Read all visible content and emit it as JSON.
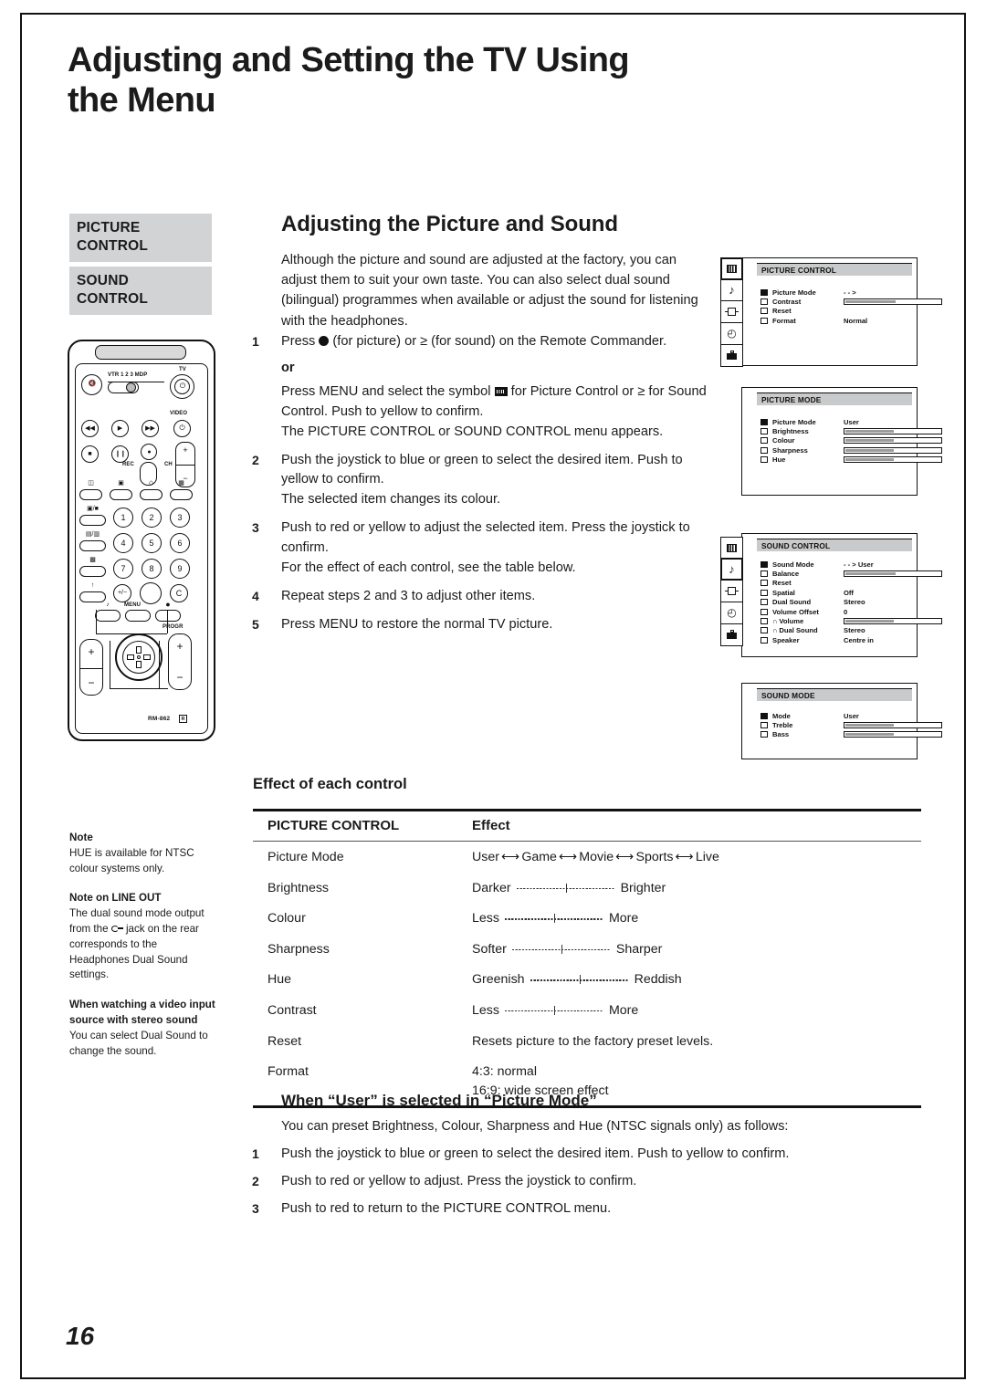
{
  "page": {
    "title_line1": "Adjusting and Setting the TV Using",
    "title_line2": "the Menu",
    "number": "16"
  },
  "sidebar": {
    "tabs": [
      {
        "line1": "PICTURE",
        "line2": "CONTROL"
      },
      {
        "line1": "SOUND",
        "line2": "CONTROL"
      }
    ]
  },
  "remote": {
    "source_labels": "VTR 1 2 3 MDP",
    "tv_label": "TV",
    "video_label": "VIDEO",
    "rec_label": "REC",
    "ch_label": "CH",
    "menu_label": "MENU",
    "progr_label": "PROGR",
    "keys": [
      "1",
      "2",
      "3",
      "4",
      "5",
      "6",
      "7",
      "8",
      "9"
    ],
    "clear_key": "C",
    "model": "RM-862",
    "region_mark": "R"
  },
  "main": {
    "section_title": "Adjusting the Picture and Sound",
    "intro": "Although the picture and sound are adjusted at the factory, you can adjust them to suit your own taste. You can also select dual sound (bilingual) programmes when available or adjust the sound for listening with the headphones.",
    "or_label": "or",
    "steps": [
      {
        "num": "1",
        "text_before_dot": "Press ",
        "text_after_dot": " (for picture) or ≥ (for sound) on the Remote Commander."
      },
      {
        "num": "",
        "text_before_sym": "Press MENU and select the symbol ",
        "text_after_sym": " for Picture Control or ≥ for Sound Control.  Push to yellow to confirm.",
        "sub": "The PICTURE CONTROL or SOUND CONTROL menu appears."
      },
      {
        "num": "2",
        "main": "Push the joystick to blue or green to select the desired item.  Push to yellow to confirm.",
        "sub": "The selected item changes its colour."
      },
      {
        "num": "3",
        "main": "Push to red or yellow to adjust the selected item.  Press the joystick to confirm.",
        "sub": "For the effect of each control, see the table below."
      },
      {
        "num": "4",
        "main": "Repeat steps 2 and 3 to adjust other items."
      },
      {
        "num": "5",
        "main": "Press MENU to restore the normal TV picture."
      }
    ]
  },
  "osd": {
    "picture_control": {
      "title": "PICTURE CONTROL",
      "rows": [
        {
          "selected": true,
          "label": "Picture Mode",
          "value": "- - >",
          "type": "value"
        },
        {
          "selected": false,
          "label": "Contrast",
          "bar": 52,
          "type": "bar"
        },
        {
          "selected": false,
          "label": "Reset",
          "value": "",
          "type": "value"
        },
        {
          "selected": false,
          "label": "Format",
          "value": "Normal",
          "type": "value"
        }
      ]
    },
    "picture_mode": {
      "title": "PICTURE MODE",
      "rows": [
        {
          "selected": true,
          "label": "Picture Mode",
          "value": "User",
          "type": "value"
        },
        {
          "selected": false,
          "label": "Brightness",
          "bar": 50,
          "type": "bar"
        },
        {
          "selected": false,
          "label": "Colour",
          "bar": 50,
          "type": "bar"
        },
        {
          "selected": false,
          "label": "Sharpness",
          "bar": 50,
          "type": "bar"
        },
        {
          "selected": false,
          "label": "Hue",
          "bar": 50,
          "type": "bar"
        }
      ]
    },
    "sound_control": {
      "title": "SOUND CONTROL",
      "rows": [
        {
          "selected": true,
          "label": "Sound Mode",
          "value": "- - > User",
          "type": "value"
        },
        {
          "selected": false,
          "label": "Balance",
          "bar": 52,
          "type": "bar"
        },
        {
          "selected": false,
          "label": "Reset",
          "value": "",
          "type": "value"
        },
        {
          "selected": false,
          "label": "Spatial",
          "value": "Off",
          "type": "value"
        },
        {
          "selected": false,
          "label": "Dual Sound",
          "value": "Stereo",
          "type": "value"
        },
        {
          "selected": false,
          "label": "Volume Offset",
          "value": "0",
          "type": "value"
        },
        {
          "selected": false,
          "label": "Volume",
          "bar": 50,
          "headphone": true,
          "type": "bar"
        },
        {
          "selected": false,
          "label": "Dual Sound",
          "value": "Stereo",
          "headphone": true,
          "type": "value"
        },
        {
          "selected": false,
          "label": "Speaker",
          "value": "Centre in",
          "type": "value"
        }
      ]
    },
    "sound_mode": {
      "title": "SOUND MODE",
      "rows": [
        {
          "selected": true,
          "label": "Mode",
          "value": "User",
          "type": "value"
        },
        {
          "selected": false,
          "label": "Treble",
          "bar": 50,
          "type": "bar"
        },
        {
          "selected": false,
          "label": "Bass",
          "bar": 50,
          "type": "bar"
        }
      ]
    },
    "tab_icons": [
      "picture-icon",
      "music-note-icon",
      "input-icon",
      "clock-icon",
      "toolbox-icon"
    ]
  },
  "notes": [
    {
      "heading": "Note",
      "body": "HUE is available for NTSC colour systems only."
    },
    {
      "heading": "Note on LINE OUT",
      "body_part1": "The dual sound mode output from the ",
      "jack_icon": "line-out-jack-icon",
      "body_part2": " jack on the rear corresponds to the Headphones Dual Sound settings."
    },
    {
      "heading": "When watching a video input source with stereo sound",
      "body": "You can select Dual Sound to change the sound."
    }
  ],
  "effect_table": {
    "heading": "Effect of each control",
    "col1_header": "PICTURE CONTROL",
    "col2_header": "Effect",
    "rows": [
      {
        "name": "Picture Mode",
        "type": "chain",
        "chain": [
          "User",
          "Game",
          "Movie",
          "Sports",
          "Live"
        ]
      },
      {
        "name": "Brightness",
        "type": "range",
        "left": "Darker",
        "right": "Brighter"
      },
      {
        "name": "Colour",
        "type": "range",
        "left": "Less",
        "right": "More"
      },
      {
        "name": "Sharpness",
        "type": "range",
        "left": "Softer",
        "right": "Sharper"
      },
      {
        "name": "Hue",
        "type": "range",
        "left": "Greenish",
        "right": "Reddish"
      },
      {
        "name": "Contrast",
        "type": "range",
        "left": "Less",
        "right": "More"
      },
      {
        "name": "Reset",
        "type": "text",
        "text": "Resets picture to the factory preset levels."
      },
      {
        "name": "Format",
        "type": "lines",
        "line1": "4:3:   normal",
        "line2": "16:9: wide screen effect"
      }
    ]
  },
  "user_section": {
    "title": "When “User” is selected in “Picture Mode”",
    "intro": "You can preset Brightness, Colour, Sharpness and Hue (NTSC signals only) as follows:",
    "steps": [
      {
        "num": "1",
        "text": "Push the joystick to blue or green to select the desired item.  Push to yellow to confirm."
      },
      {
        "num": "2",
        "text": "Push to red or yellow to adjust.  Press the joystick to confirm."
      },
      {
        "num": "3",
        "text": "Push to red to return to the PICTURE CONTROL menu."
      }
    ]
  }
}
